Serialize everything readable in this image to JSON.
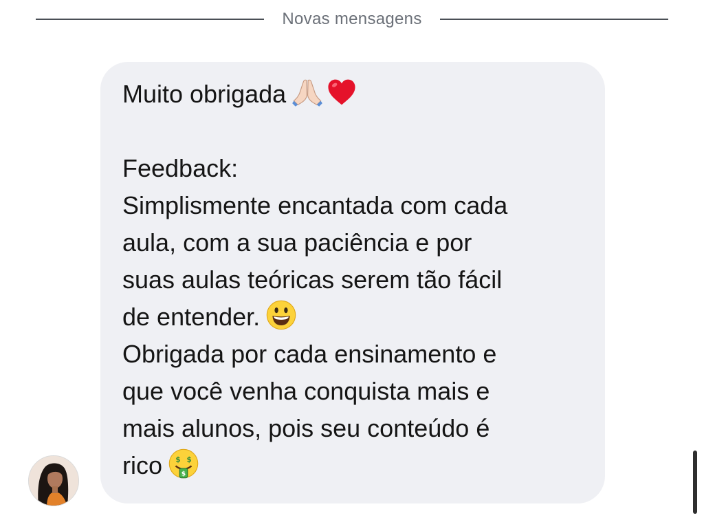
{
  "divider": {
    "label": "Novas mensagens"
  },
  "message": {
    "greeting": "Muito obrigada",
    "greeting_emojis": [
      "folded-hands-icon",
      "red-heart-icon"
    ],
    "feedback_label": "Feedback:",
    "line1": "Simplismente encantada com cada",
    "line2": "aula, com a sua paciência e por",
    "line3": "suas aulas teóricas serem tão fácil",
    "line4": "de entender.",
    "line4_emoji": "smiling-face-icon",
    "line5": "Obrigada por cada ensinamento e",
    "line6": "que você venha conquista mais e",
    "line7": "mais alunos, pois seu conteúdo é",
    "line8": "rico",
    "line8_emoji": "money-mouth-face-icon"
  },
  "colors": {
    "bubble": "#eff0f4",
    "text": "#151515",
    "divider_text": "#6b7078",
    "divider_line": "#4a4f55"
  }
}
